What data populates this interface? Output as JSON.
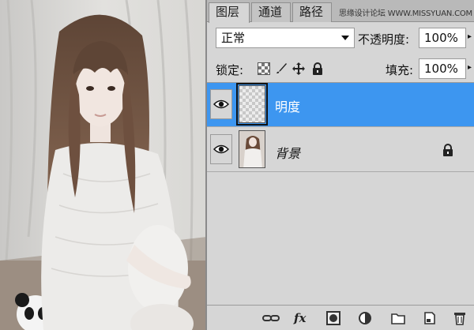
{
  "tabs": [
    {
      "label": "图层",
      "active": true
    },
    {
      "label": "通道",
      "active": false
    },
    {
      "label": "路径",
      "active": false
    }
  ],
  "watermark": "思缘设计论坛 WWW.MISSYUAN.COM",
  "blend_mode": {
    "value": "正常"
  },
  "opacity": {
    "label": "不透明度:",
    "value": "100%"
  },
  "lock": {
    "label": "锁定:"
  },
  "fill": {
    "label": "填充:",
    "value": "100%"
  },
  "layers": [
    {
      "name": "明度",
      "selected": true,
      "visible": true,
      "locked": false
    },
    {
      "name": "背景",
      "selected": false,
      "visible": true,
      "locked": true
    }
  ],
  "colors": {
    "selection": "#3d96f0",
    "panel": "#d6d6d6",
    "tabbar": "#b9b9b9"
  },
  "toolbar_icons": [
    "link-layers-icon",
    "fx-icon",
    "add-mask-icon",
    "adjustment-layer-icon",
    "new-group-icon",
    "new-layer-icon",
    "delete-layer-icon"
  ],
  "toolbar": {
    "fx_label": "fx"
  }
}
